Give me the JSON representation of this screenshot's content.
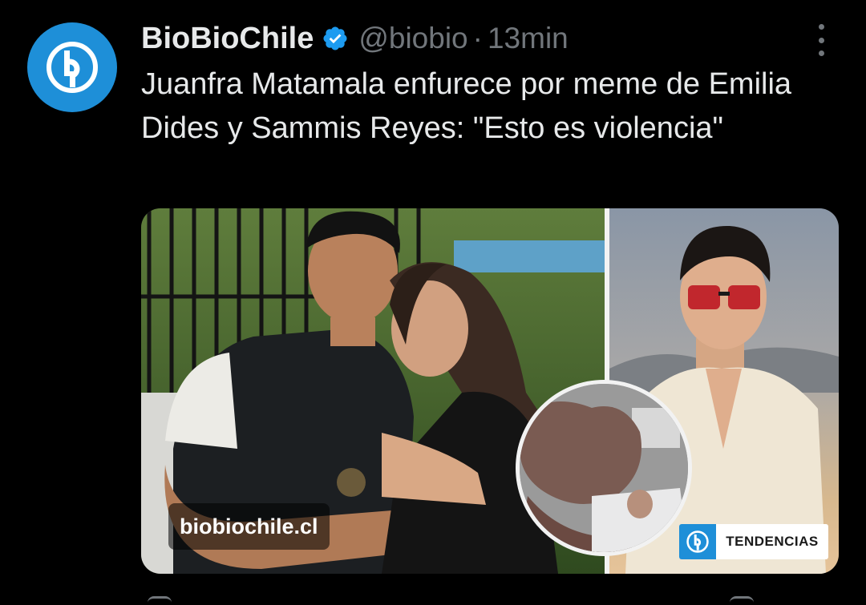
{
  "tweet": {
    "display_name": "BioBioChile",
    "handle": "@biobio",
    "separator": "·",
    "time": "13min",
    "text": "Juanfra Matamala enfurece por meme de Emilia Dides y Sammis Reyes: \"Esto es violencia\""
  },
  "card": {
    "source_label": "biobiochile.cl",
    "tag_label": "TENDENCIAS"
  },
  "icons": {
    "avatar": "biobio-logo-icon",
    "verified": "verified-badge-icon",
    "more": "more-options-icon"
  },
  "colors": {
    "background": "#000000",
    "text_primary": "#e7e9ea",
    "text_secondary": "#71767b",
    "brand_blue": "#1e8fd8",
    "verified_blue": "#1d9bf0"
  }
}
